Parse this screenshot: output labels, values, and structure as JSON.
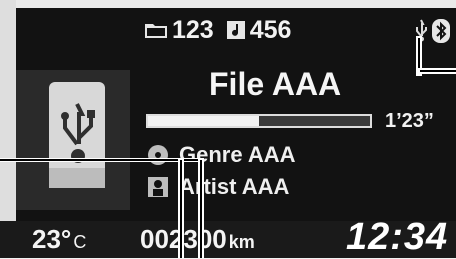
{
  "status": {
    "folder_icon": "folder-icon",
    "folder_count": "123",
    "track_icon": "music-file-icon",
    "track_count": "456",
    "connection_icons": [
      "usb-icon",
      "bluetooth-icon"
    ]
  },
  "source": {
    "device_icon": "usb-device-icon"
  },
  "now_playing": {
    "title": "File AAA",
    "elapsed": "1’23”",
    "progress": 0.5,
    "genre_icon": "disc-icon",
    "genre": "Genre AAA",
    "artist_icon": "person-icon",
    "artist": "Artist AAA"
  },
  "bottom": {
    "temperature": "23°",
    "temperature_unit": "C",
    "odometer": "002300",
    "odometer_unit": "km",
    "clock": "12:34"
  }
}
